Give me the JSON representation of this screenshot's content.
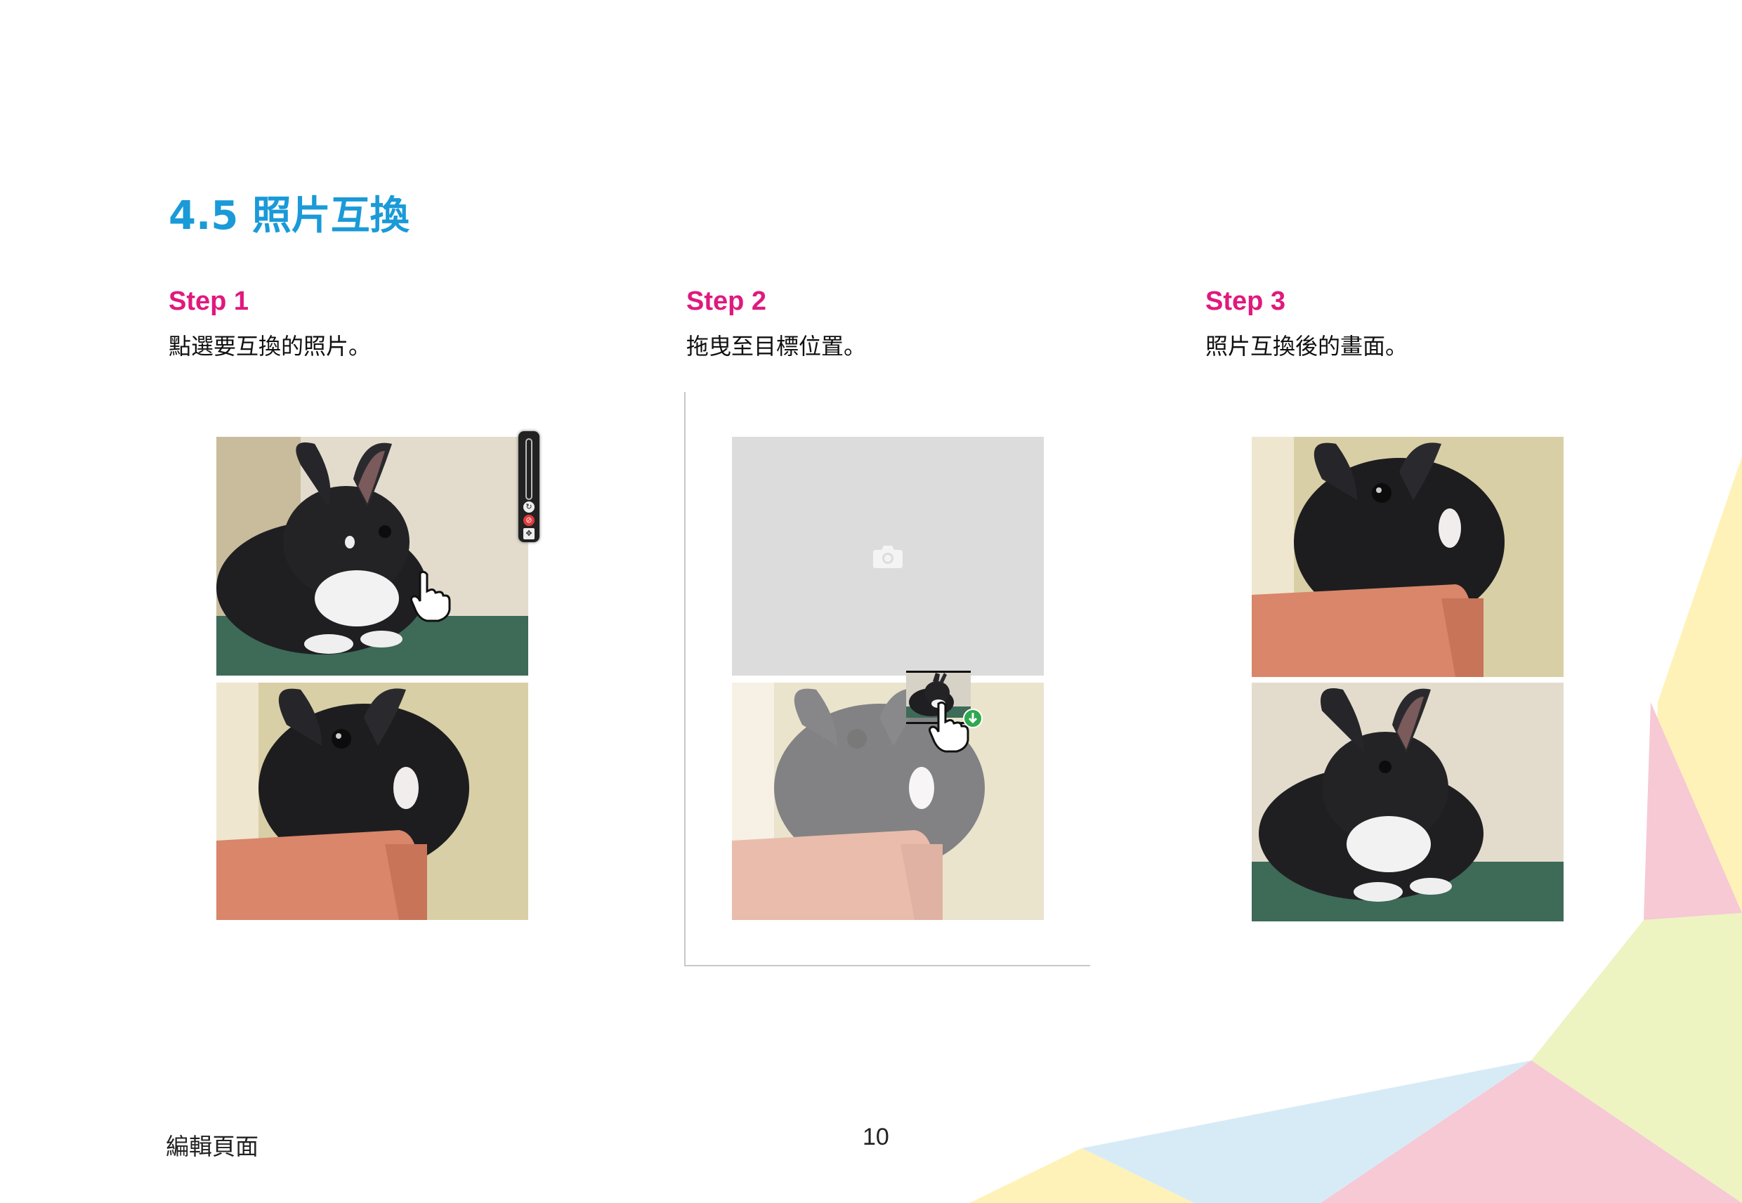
{
  "page": {
    "title": "4.5 照片互換",
    "footer_section": "編輯頁面",
    "page_number": "10"
  },
  "steps": [
    {
      "title": "Step 1",
      "description": "點選要互換的照片。"
    },
    {
      "title": "Step 2",
      "description": "拖曳至目標位置。"
    },
    {
      "title": "Step 3",
      "description": "照片互換後的畫面。"
    }
  ],
  "icons": {
    "hand_cursor": "hand-pointer-icon",
    "camera": "camera-icon",
    "swap_badge": "download-arrow-icon",
    "rotate": "rotate-icon",
    "delete": "delete-icon",
    "resize": "resize-icon"
  },
  "colors": {
    "title": "#1a9ad8",
    "step_title": "#e0197d",
    "placeholder": "#dcdcdc",
    "badge": "#2fa84f"
  }
}
